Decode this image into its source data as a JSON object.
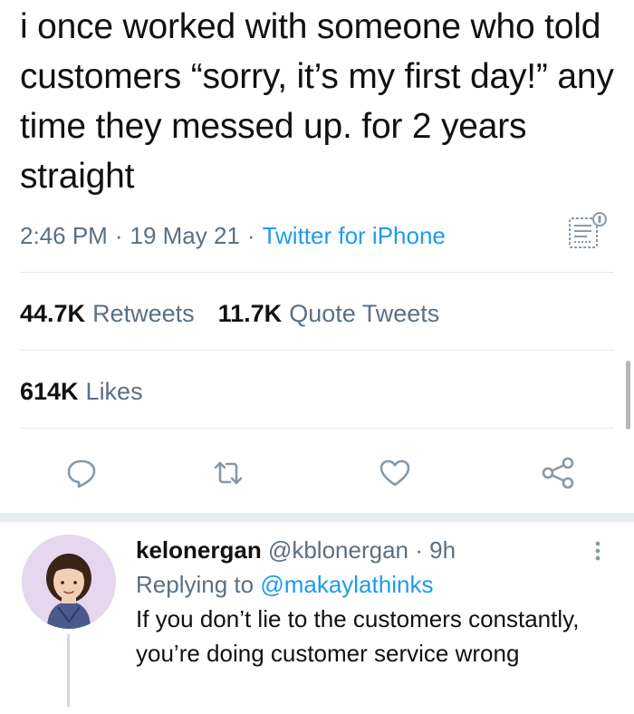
{
  "tweet": {
    "text": "i once worked with someone who told customers “sorry, it’s my first day!” any time they messed up. for 2 years straight",
    "time": "2:46 PM",
    "date": "19 May 21",
    "source": "Twitter for iPhone",
    "separator": "·"
  },
  "stats": {
    "retweets_count": "44.7K",
    "retweets_label": "Retweets",
    "quotes_count": "11.7K",
    "quotes_label": "Quote Tweets",
    "likes_count": "614K",
    "likes_label": "Likes"
  },
  "actions": [
    "reply-icon",
    "retweet-icon",
    "like-icon",
    "share-icon"
  ],
  "reply": {
    "display_name": "kelonergan",
    "handle": "@kblonergan",
    "separator": "·",
    "age": "9h",
    "replying_prefix": "Replying to",
    "replying_to": "@makaylathinks",
    "text": "If you don’t lie to the customers constantly, you’re doing customer service wrong"
  },
  "colors": {
    "link": "#1d9bf0",
    "secondary": "#5b7083",
    "divider": "#e1e8ed"
  }
}
